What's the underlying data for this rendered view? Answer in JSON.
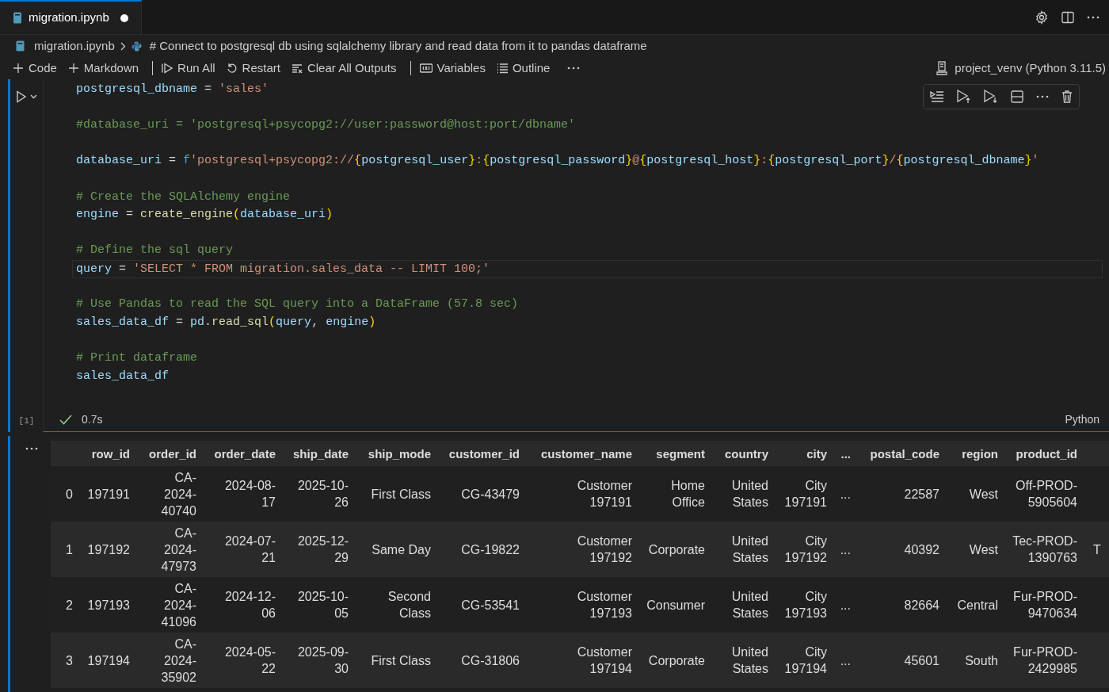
{
  "tabs": [
    {
      "label": "migration.ipynb",
      "selected": true,
      "modified": true
    }
  ],
  "breadcrumb": [
    "migration.ipynb",
    "# Connect to postgresql db using sqlalchemy library and read data from it to pandas dataframe"
  ],
  "toolbar_groups": [
    [
      {
        "kind": "add",
        "label": "Code"
      },
      {
        "kind": "add",
        "label": "Markdown"
      }
    ],
    [
      {
        "kind": "run-all",
        "label": "Run All"
      },
      {
        "kind": "restart",
        "label": "Restart"
      },
      {
        "kind": "clear",
        "label": "Clear All Outputs"
      }
    ],
    [
      {
        "kind": "variables",
        "label": "Variables"
      },
      {
        "kind": "outline",
        "label": "Outline"
      }
    ]
  ],
  "kernel": "project_venv (Python 3.11.5)",
  "cell": {
    "execution_count": "[1]",
    "succeeded": true,
    "duration": "0.7s",
    "language": "Python",
    "code_blocks": [
      [
        {
          "current": false,
          "tokens": [
            {
              "kind": "var",
              "t": "postgresql_dbname"
            },
            {
              "kind": "op",
              "t": " = "
            },
            {
              "kind": "str",
              "t": "'sales'"
            }
          ]
        }
      ],
      [
        {
          "current": false,
          "tokens": [
            {
              "kind": "comment",
              "t": "#database_uri = 'postgresql+psycopg2://user:password@host:port/dbname'"
            }
          ]
        }
      ],
      [
        {
          "current": false,
          "tokens": [
            {
              "kind": "var",
              "t": "database_uri"
            },
            {
              "kind": "op",
              "t": " = "
            },
            {
              "kind": "kw",
              "t": "f"
            },
            {
              "kind": "str",
              "t": "'postgresql+psycopg2://"
            },
            {
              "kind": "brace",
              "t": "{"
            },
            {
              "kind": "var",
              "t": "postgresql_user"
            },
            {
              "kind": "brace",
              "t": "}"
            },
            {
              "kind": "str",
              "t": ":"
            },
            {
              "kind": "brace",
              "t": "{"
            },
            {
              "kind": "var",
              "t": "postgresql_password"
            },
            {
              "kind": "brace",
              "t": "}"
            },
            {
              "kind": "str",
              "t": "@"
            },
            {
              "kind": "brace",
              "t": "{"
            },
            {
              "kind": "var",
              "t": "postgresql_host"
            },
            {
              "kind": "brace",
              "t": "}"
            },
            {
              "kind": "str",
              "t": ":"
            },
            {
              "kind": "brace",
              "t": "{"
            },
            {
              "kind": "var",
              "t": "postgresql_port"
            },
            {
              "kind": "brace",
              "t": "}"
            },
            {
              "kind": "str",
              "t": "/"
            },
            {
              "kind": "brace",
              "t": "{"
            },
            {
              "kind": "var",
              "t": "postgresql_dbname"
            },
            {
              "kind": "brace",
              "t": "}"
            },
            {
              "kind": "str",
              "t": "'"
            }
          ]
        }
      ],
      [
        {
          "current": false,
          "tokens": [
            {
              "kind": "comment",
              "t": "# Create the SQLAlchemy engine"
            }
          ]
        },
        {
          "current": false,
          "tokens": [
            {
              "kind": "var",
              "t": "engine"
            },
            {
              "kind": "op",
              "t": " = "
            },
            {
              "kind": "func",
              "t": "create_engine"
            },
            {
              "kind": "brace",
              "t": "("
            },
            {
              "kind": "var",
              "t": "database_uri"
            },
            {
              "kind": "brace",
              "t": ")"
            }
          ]
        }
      ],
      [
        {
          "current": false,
          "tokens": [
            {
              "kind": "comment",
              "t": "# Define the sql query"
            }
          ]
        },
        {
          "current": true,
          "tokens": [
            {
              "kind": "var",
              "t": "query"
            },
            {
              "kind": "op",
              "t": " = "
            },
            {
              "kind": "str",
              "t": "'SELECT * FROM migration.sales_data -- LIMIT 100;'"
            }
          ]
        }
      ],
      [
        {
          "current": false,
          "tokens": [
            {
              "kind": "comment",
              "t": "# Use Pandas to read the SQL query into a DataFrame (57.8 sec)"
            }
          ]
        },
        {
          "current": false,
          "tokens": [
            {
              "kind": "var",
              "t": "sales_data_df"
            },
            {
              "kind": "op",
              "t": " = "
            },
            {
              "kind": "var",
              "t": "pd"
            },
            {
              "kind": "op",
              "t": "."
            },
            {
              "kind": "func",
              "t": "read_sql"
            },
            {
              "kind": "brace",
              "t": "("
            },
            {
              "kind": "var",
              "t": "query"
            },
            {
              "kind": "op",
              "t": ", "
            },
            {
              "kind": "var",
              "t": "engine"
            },
            {
              "kind": "brace",
              "t": ")"
            }
          ]
        }
      ],
      [
        {
          "current": false,
          "tokens": [
            {
              "kind": "comment",
              "t": "# Print dataframe"
            }
          ]
        },
        {
          "current": false,
          "tokens": [
            {
              "kind": "var",
              "t": "sales_data_df"
            }
          ]
        }
      ]
    ]
  },
  "output": {
    "columns": [
      "row_id",
      "order_id",
      "order_date",
      "ship_date",
      "ship_mode",
      "customer_id",
      "customer_name",
      "segment",
      "country",
      "city",
      "...",
      "postal_code",
      "region",
      "product_id"
    ],
    "rows": [
      {
        "index": "0",
        "cells": [
          "197191",
          "CA-2024-40740",
          "2024-08-17",
          "2025-10-26",
          "First Class",
          "CG-43479",
          "Customer 197191",
          "Home Office",
          "United States",
          "City 197191",
          "...",
          "22587",
          "West",
          "Off-PROD-5905604"
        ]
      },
      {
        "index": "1",
        "cells": [
          "197192",
          "CA-2024-47973",
          "2024-07-21",
          "2025-12-29",
          "Same Day",
          "CG-19822",
          "Customer 197192",
          "Corporate",
          "United States",
          "City 197192",
          "...",
          "40392",
          "West",
          "Tec-PROD-1390763",
          "T"
        ]
      },
      {
        "index": "2",
        "cells": [
          "197193",
          "CA-2024-41096",
          "2024-12-06",
          "2025-10-05",
          "Second Class",
          "CG-53541",
          "Customer 197193",
          "Consumer",
          "United States",
          "City 197193",
          "...",
          "82664",
          "Central",
          "Fur-PROD-9470634"
        ]
      },
      {
        "index": "3",
        "cells": [
          "197194",
          "CA-2024-35902",
          "2024-05-22",
          "2025-09-30",
          "First Class",
          "CG-31806",
          "Customer 197194",
          "Corporate",
          "United States",
          "City 197194",
          "...",
          "45601",
          "South",
          "Fur-PROD-2429985"
        ]
      }
    ]
  }
}
